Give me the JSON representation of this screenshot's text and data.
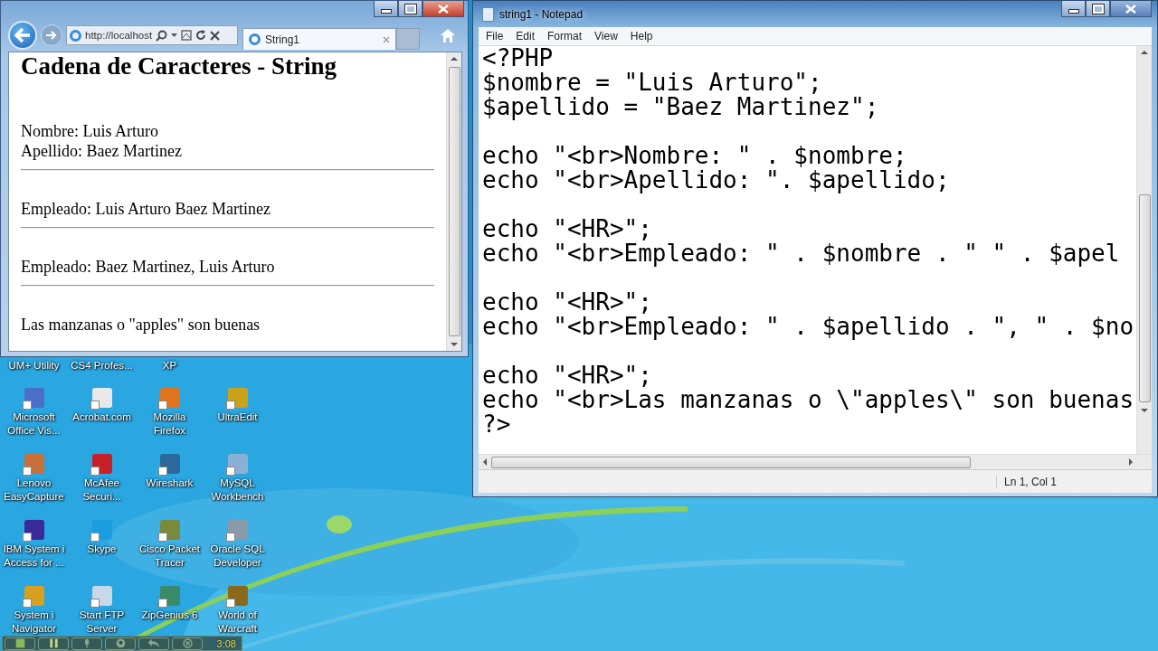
{
  "desktop": {
    "cut_labels": [
      "UM+ Utility",
      "CS4 Profes...",
      "XP"
    ],
    "icons": [
      {
        "label": "Microsoft Office Vis..."
      },
      {
        "label": "Acrobat.com"
      },
      {
        "label": "Mozilla Firefox"
      },
      {
        "label": "UltraEdit"
      },
      {
        "label": "Lenovo EasyCapture"
      },
      {
        "label": "McAfee Securi..."
      },
      {
        "label": "Wireshark"
      },
      {
        "label": "MySQL Workbench"
      },
      {
        "label": "IBM System i Access for ..."
      },
      {
        "label": "Skype"
      },
      {
        "label": "Cisco Packet Tracer"
      },
      {
        "label": "Oracle SQL Developer"
      },
      {
        "label": "System i Navigator"
      },
      {
        "label": "Start FTP Server"
      },
      {
        "label": "ZipGenius 6"
      },
      {
        "label": "World of Warcraft"
      }
    ]
  },
  "recorder": {
    "time": "3:08",
    "buttons": [
      {
        "kind": "stop"
      },
      {
        "kind": "pause"
      },
      {
        "kind": "mic"
      },
      {
        "kind": "webcam"
      },
      {
        "kind": "undo"
      },
      {
        "kind": "cancel"
      }
    ]
  },
  "browser": {
    "address": "http://localhost",
    "tab": {
      "label": "String1",
      "selected": true
    },
    "page": [
      {
        "kind": "heading",
        "text": "Cadena de Caracteres - String"
      },
      {
        "kind": "text",
        "text": "Nombre: Luis Arturo"
      },
      {
        "kind": "text",
        "text": "Apellido: Baez Martinez"
      },
      {
        "kind": "rule"
      },
      {
        "kind": "text",
        "text": "Empleado: Luis Arturo Baez Martinez"
      },
      {
        "kind": "rule"
      },
      {
        "kind": "text",
        "text": "Empleado: Baez Martinez, Luis Arturo"
      },
      {
        "kind": "rule"
      },
      {
        "kind": "text",
        "text": "Las manzanas o \"apples\" son buenas"
      }
    ]
  },
  "notepad": {
    "title": "string1 - Notepad",
    "menu": [
      "File",
      "Edit",
      "Format",
      "View",
      "Help"
    ],
    "lines": [
      {
        "kind": "code",
        "text": "<?PHP"
      },
      {
        "kind": "code",
        "text": "$nombre = \"Luis Arturo\";"
      },
      {
        "kind": "code",
        "text": "$apellido = \"Baez Martinez\";"
      },
      {
        "kind": "blank"
      },
      {
        "kind": "code",
        "text": "echo \"<br>Nombre: \" . $nombre;"
      },
      {
        "kind": "code",
        "text": "echo \"<br>Apellido: \". $apellido;"
      },
      {
        "kind": "blank"
      },
      {
        "kind": "code",
        "text": "echo \"<HR>\";"
      },
      {
        "kind": "code",
        "text": "echo \"<br>Empleado: \" . $nombre . \" \" . $apel"
      },
      {
        "kind": "blank"
      },
      {
        "kind": "code",
        "text": "echo \"<HR>\";"
      },
      {
        "kind": "code",
        "text": "echo \"<br>Empleado: \" . $apellido . \", \" . $no"
      },
      {
        "kind": "blank"
      },
      {
        "kind": "code",
        "text": "echo \"<HR>\";"
      },
      {
        "kind": "code",
        "text": "echo \"<br>Las manzanas o \\\"apples\\\" son buenas"
      },
      {
        "kind": "code",
        "text": "?>"
      }
    ],
    "status": "Ln 1, Col 1"
  }
}
